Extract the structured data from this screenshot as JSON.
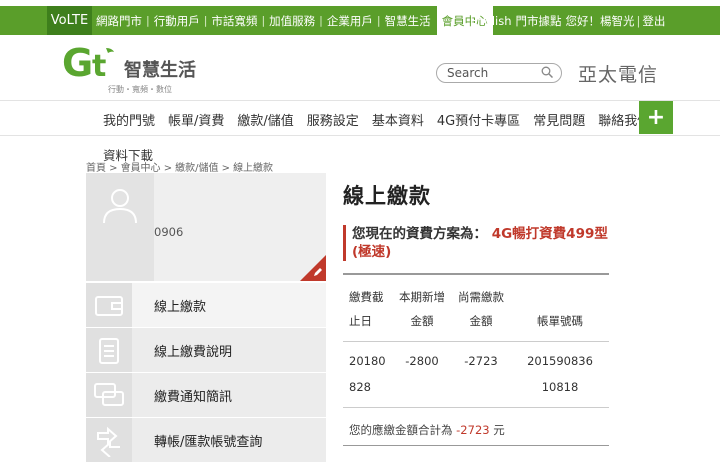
{
  "topbar": {
    "volte": "VoLTE",
    "nav": [
      "網路門市",
      "行動用戶",
      "市話寬頻",
      "加值服務",
      "企業用戶",
      "智慧生活"
    ],
    "active": "會員中心",
    "links": [
      "English",
      "門市據點",
      "您好！楊智光",
      "登出"
    ]
  },
  "header": {
    "logo_text": "智慧生活",
    "logo_tagline": "行動・寬頻・數位",
    "search_placeholder": "Search",
    "brand": "亞太電信"
  },
  "mainnav": {
    "items": [
      "我的門號",
      "帳單/資費",
      "繳款/儲值",
      "服務設定",
      "基本資料",
      "4G預付卡專區",
      "常見問題",
      "聯絡我們"
    ],
    "plus": "+",
    "submenu": "資料下載"
  },
  "breadcrumb": [
    "首頁 >",
    "會員中心 >",
    "繳款/儲值 >",
    "線上繳款"
  ],
  "profile": {
    "phone": "0906"
  },
  "menu": [
    {
      "label": "線上繳款",
      "icon": "wallet-icon"
    },
    {
      "label": "線上繳費說明",
      "icon": "clipboard-icon"
    },
    {
      "label": "繳費通知簡訊",
      "icon": "chat-icon"
    },
    {
      "label": "轉帳/匯款帳號查詢",
      "icon": "transfer-icon"
    }
  ],
  "content": {
    "title": "線上繳款",
    "plan_label": "您現在的資費方案為：",
    "plan_value": "4G暢打資費499型(極速)",
    "table": {
      "headers": [
        [
          "繳費截",
          "止日"
        ],
        [
          "本期新增",
          "金額"
        ],
        [
          "尚需繳款",
          "金額"
        ],
        [
          "",
          "帳單號碼"
        ]
      ],
      "row": [
        [
          "20180",
          "828"
        ],
        [
          "-2800"
        ],
        [
          "-2723"
        ],
        [
          "201590836",
          "10818"
        ]
      ]
    },
    "total_label": "您的應繳金額合計為",
    "total_amount": "-2723",
    "total_unit": "元"
  },
  "colors": {
    "green": "#5a9e2a",
    "red": "#c0392b"
  }
}
